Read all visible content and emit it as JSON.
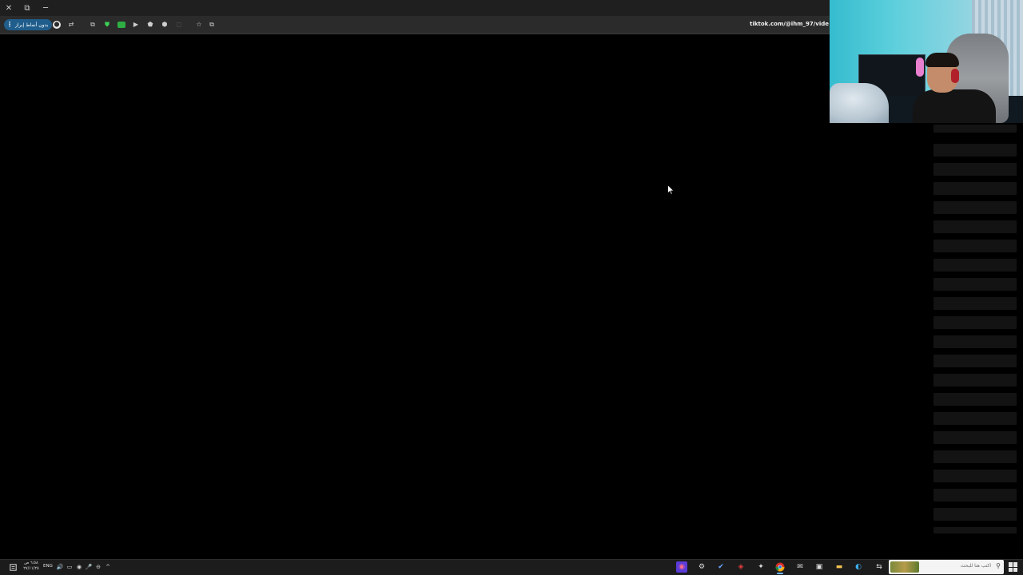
{
  "browser": {
    "window_controls": {
      "close": "✕",
      "restore": "⧉",
      "minimize": "─"
    },
    "menu_pill_label": "بدون أنماط إبراز",
    "menu_dots": "⋮",
    "url": "tiktok.com/@ihm_97/vide",
    "toolbar_icons": [
      "⬤",
      "⇄",
      "⧉",
      "⛊",
      "▬",
      "▶",
      "⬟",
      "⬢",
      "◻",
      "☆",
      "⧉"
    ]
  },
  "taskbar": {
    "clock_time": "٦:٥٨ ص",
    "clock_date": "٢٧/١١/٢٥",
    "language": "ENG",
    "search_placeholder": "اكتب هنا للبحث",
    "tray_icons": [
      "⌂",
      "🔊",
      "▭",
      "◉",
      "🎤",
      "⊖",
      "^"
    ],
    "app_icons": [
      "◉",
      "⚙",
      "✔",
      "◈",
      "✦",
      "◎",
      "✉",
      "▣",
      "▬",
      "◐",
      "⇆"
    ]
  },
  "colors": {
    "menu_pill": "#1f5d8c",
    "background": "#000000",
    "taskbar": "#1c1c1c"
  }
}
